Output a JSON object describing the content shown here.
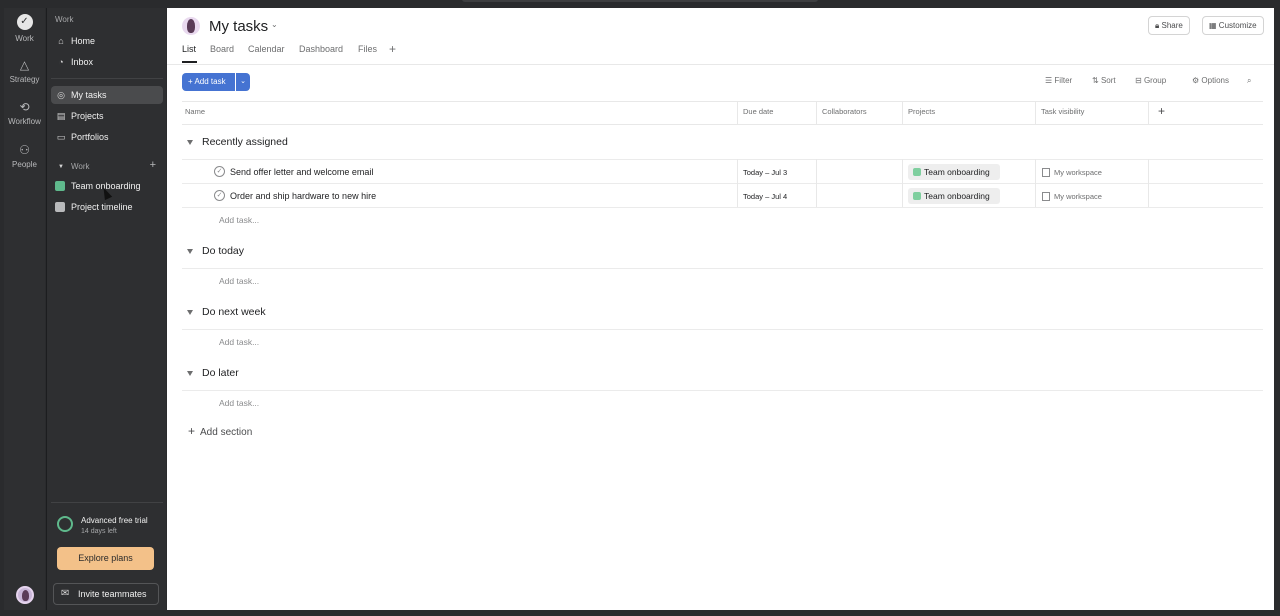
{
  "rail": {
    "items": [
      {
        "label": "Work",
        "icon": "check-circle-icon"
      },
      {
        "label": "Strategy",
        "icon": "triangle-icon"
      },
      {
        "label": "Workflow",
        "icon": "workflow-icon"
      },
      {
        "label": "People",
        "icon": "people-icon"
      }
    ]
  },
  "sidebar": {
    "header": "Work",
    "nav": [
      {
        "label": "Home",
        "icon": "home-icon"
      },
      {
        "label": "Inbox",
        "icon": "bell-icon"
      },
      {
        "label": "My tasks",
        "icon": "check-circle-icon"
      },
      {
        "label": "Projects",
        "icon": "clipboard-icon"
      },
      {
        "label": "Portfolios",
        "icon": "folder-icon"
      }
    ],
    "group_label": "Work",
    "projects": [
      {
        "label": "Team onboarding",
        "color": "#5fb98c"
      },
      {
        "label": "Project timeline",
        "color": "#b8b9bb"
      }
    ],
    "trial": {
      "title": "Advanced free trial",
      "days_left": "14 days left",
      "cta": "Explore plans"
    },
    "invite": "Invite teammates"
  },
  "header": {
    "title": "My tasks",
    "tabs": [
      "List",
      "Board",
      "Calendar",
      "Dashboard",
      "Files"
    ],
    "share": "Share",
    "customize": "Customize"
  },
  "toolbar": {
    "add_task": "+ Add task",
    "filter": "Filter",
    "sort": "Sort",
    "group": "Group",
    "options": "Options"
  },
  "columns": [
    "Name",
    "Due date",
    "Collaborators",
    "Projects",
    "Task visibility"
  ],
  "sections": [
    {
      "title": "Recently assigned",
      "tasks": [
        {
          "name": "Send offer letter and welcome email",
          "due": "Today – Jul 3",
          "project": "Team onboarding",
          "visibility": "My workspace"
        },
        {
          "name": "Order and ship hardware to new hire",
          "due": "Today – Jul 4",
          "project": "Team onboarding",
          "visibility": "My workspace"
        }
      ]
    },
    {
      "title": "Do today",
      "tasks": []
    },
    {
      "title": "Do next week",
      "tasks": []
    },
    {
      "title": "Do later",
      "tasks": []
    }
  ],
  "add_task_label": "Add task...",
  "add_section_label": "Add section",
  "colors": {
    "accent": "#4573d2",
    "cta": "#f3c189",
    "project": "#7fcf9f"
  }
}
